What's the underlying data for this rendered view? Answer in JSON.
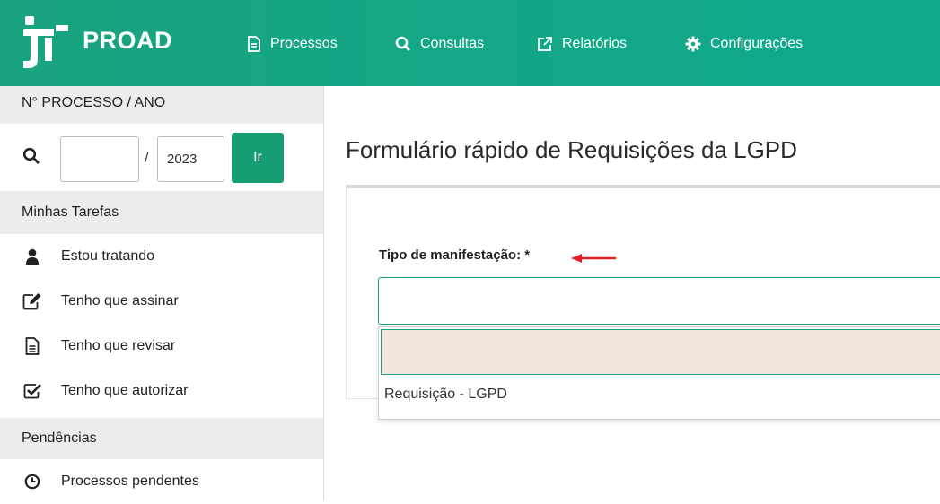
{
  "app": {
    "brand": "PROAD"
  },
  "nav": [
    {
      "label": "Processos",
      "icon": "file-text-icon"
    },
    {
      "label": "Consultas",
      "icon": "search-icon"
    },
    {
      "label": "Relatórios",
      "icon": "external-link-icon"
    },
    {
      "label": "Configurações",
      "icon": "gear-icon"
    }
  ],
  "sidebar": {
    "process_header": "N° PROCESSO / ANO",
    "search": {
      "number_value": "",
      "year_value": "2023",
      "separator": "/",
      "go_label": "Ir"
    },
    "tasks_header": "Minhas Tarefas",
    "tasks": [
      {
        "label": "Estou tratando",
        "icon": "user-icon"
      },
      {
        "label": "Tenho que assinar",
        "icon": "edit-icon"
      },
      {
        "label": "Tenho que revisar",
        "icon": "file-text-icon"
      },
      {
        "label": "Tenho que autorizar",
        "icon": "check-square-icon"
      }
    ],
    "pending_header": "Pendências",
    "pending": [
      {
        "label": "Processos pendentes",
        "icon": "clock-icon"
      }
    ]
  },
  "main": {
    "title": "Formulário rápido de Requisições da LGPD",
    "form": {
      "field_label": "Tipo de manifestação: *",
      "selected_value": "",
      "options": [
        "",
        "Requisição - LGPD"
      ]
    }
  },
  "colors": {
    "header": "#12a586",
    "accent": "#169d74",
    "highlight": "#f1e7dc",
    "annotation": "#e02020"
  }
}
